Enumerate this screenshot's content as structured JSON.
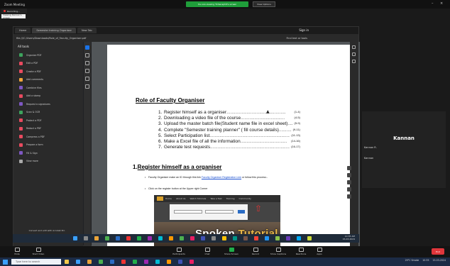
{
  "zoom": {
    "window_title": "Zoom Meeting",
    "share_banner": "You are viewing Tkhanaphit's screen",
    "view_options": "View Options",
    "recording": "Recording...",
    "viewing_label": "Viewing Kannan's screen"
  },
  "browser": {
    "tabs": [
      "Home",
      "Semester training Organiser",
      "New Tab"
    ],
    "url": "file:///C:/Users/Downloads/Role_of_Faculty_Organiser.pdf",
    "signin": "Sign in",
    "zoom_level": "Find text or tools"
  },
  "tool_pane": {
    "header": "All tools",
    "items": [
      {
        "label": "Organize PDF",
        "color": "#3da35d"
      },
      {
        "label": "Edit a PDF",
        "color": "#e84a5f"
      },
      {
        "label": "Create a PDF",
        "color": "#e84a5f"
      },
      {
        "label": "Add comments",
        "color": "#f2a53a"
      },
      {
        "label": "Combine files",
        "color": "#7e57c2"
      },
      {
        "label": "Add a stamp",
        "color": "#e84a5f"
      },
      {
        "label": "Request e-signatures",
        "color": "#7e57c2"
      },
      {
        "label": "Scan & OCR",
        "color": "#3da35d"
      },
      {
        "label": "Protect a PDF",
        "color": "#e84a5f"
      },
      {
        "label": "Redact a PDF",
        "color": "#e84a5f"
      },
      {
        "label": "Compress a PDF",
        "color": "#e84a5f"
      },
      {
        "label": "Prepare a form",
        "color": "#e84a5f"
      },
      {
        "label": "Fill & Sign",
        "color": "#7e57c2"
      },
      {
        "label": "View more",
        "color": "#aaaaaa"
      }
    ],
    "promo_text": "Convert and edit with Acrobat Pro",
    "promo_button": "Free 7-day trial"
  },
  "document": {
    "title": "Role of Faculty Organiser",
    "toc": [
      {
        "num": "1.",
        "text": "Register himself as a organiser",
        "dots": "...............................................",
        "page": "(1-4)"
      },
      {
        "num": "2.",
        "text": "Downloading a video file of the course",
        "dots": "...................................",
        "page": "(4-5)"
      },
      {
        "num": "3.",
        "text": "Upload the master batch file(Student name file in excel sheet)",
        "dots": "..........",
        "page": "(5-9)"
      },
      {
        "num": "4.",
        "text": "Complete \"Semester training planner\" ( fill course details)",
        "dots": "..............",
        "page": "(9-11)"
      },
      {
        "num": "5.",
        "text": "Select Participation list",
        "dots": "...................................................................",
        "page": "(11-13)"
      },
      {
        "num": "6.",
        "text": "Make a Excel file of all the information",
        "dots": ".....................................",
        "page": "(14-16)"
      },
      {
        "num": "7.",
        "text": "Generate test requests",
        "dots": "...................................................................",
        "page": "(16-17)"
      }
    ],
    "section_num": "1.",
    "section_title": "Register himself as a organiser",
    "bullet1_text": "Faculty Organiser make an ID through this link",
    "bullet1_link": "Faculty Organiser Registration Link",
    "bullet1_tail": "or follow this process:-",
    "bullet2_text": "Click on the register button at the Upper right Corner",
    "embed_nav": [
      "Home",
      "About Us",
      "Watch Tutorials",
      "Take a Test",
      "Training",
      "Community"
    ],
    "embed_brand_a": "Spoken",
    "embed_brand_b": "Tutorial"
  },
  "participants": [
    {
      "name": "Kannan R.",
      "big": ""
    },
    {
      "name": "",
      "big": "Kannan"
    },
    {
      "name": "Kannan",
      "big": ""
    }
  ],
  "inner_taskbar": {
    "time": "10:35 AM",
    "date": "15-03-2024"
  },
  "zoom_controls": {
    "mute": "Mute",
    "video": "Start Video",
    "participants": "Participants",
    "chat": "Chat",
    "share": "Share Screen",
    "record": "Record",
    "captions": "Show Captions",
    "reactions": "Reactions",
    "apps": "Apps",
    "end": "End"
  },
  "taskbar": {
    "search_placeholder": "Type here to search",
    "weather": "29°C Smoke",
    "time": "10:35",
    "date": "15-03-2024"
  }
}
